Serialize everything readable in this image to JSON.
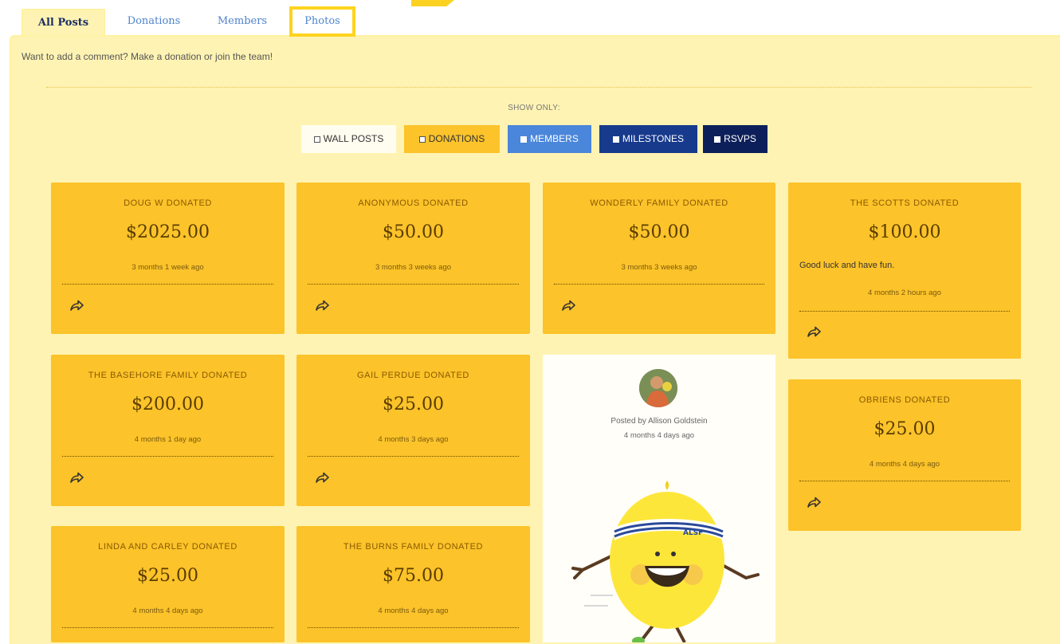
{
  "tabs": [
    {
      "label": "All Posts"
    },
    {
      "label": "Donations"
    },
    {
      "label": "Members"
    },
    {
      "label": "Photos"
    }
  ],
  "intro": "Want to add a comment? Make a donation or join the team!",
  "show_only": "SHOW ONLY:",
  "filters": [
    {
      "label": "WALL POSTS",
      "checked": false
    },
    {
      "label": "DONATIONS",
      "checked": false
    },
    {
      "label": "MEMBERS",
      "checked": true
    },
    {
      "label": "MILESTONES",
      "checked": true
    },
    {
      "label": "RSVPS",
      "checked": true
    }
  ],
  "cards": [
    {
      "title": "DOUG W DONATED",
      "amount": "$2025.00",
      "time": "3 months 1 week ago"
    },
    {
      "title": "ANONYMOUS DONATED",
      "amount": "$50.00",
      "time": "3 months 3 weeks ago"
    },
    {
      "title": "WONDERLY FAMILY DONATED",
      "amount": "$50.00",
      "time": "3 months 3 weeks ago"
    },
    {
      "title": "THE SCOTTS DONATED",
      "amount": "$100.00",
      "message": "Good luck and have fun.",
      "time": "4 months 2 hours ago"
    },
    {
      "title": "THE BASEHORE FAMILY DONATED",
      "amount": "$200.00",
      "time": "4 months 1 day ago"
    },
    {
      "title": "GAIL PERDUE DONATED",
      "amount": "$25.00",
      "time": "4 months 3 days ago"
    },
    {
      "title": "OBRIENS DONATED",
      "amount": "$25.00",
      "time": "4 months 4 days ago"
    },
    {
      "title": "LINDA AND CARLEY DONATED",
      "amount": "$25.00",
      "time": "4 months 4 days ago"
    },
    {
      "title": "THE BURNS FAMILY DONATED",
      "amount": "$75.00",
      "time": "4 months 4 days ago"
    }
  ],
  "photo_post": {
    "posted_by": "Posted by Allison Goldstein",
    "time": "4 months 4 days ago",
    "headband_text": "ALSF"
  },
  "colors": {
    "card": "#fcc32a",
    "panel": "#fff3b3",
    "tab_link": "#4f83cc",
    "highlight": "#ffd31f",
    "members_filter": "#4a86da",
    "milestones_filter": "#173a8c",
    "rsvps_filter": "#0d1f5a"
  },
  "icons": {
    "share": "share-arrow-icon",
    "checkbox": "checkbox-icon"
  }
}
